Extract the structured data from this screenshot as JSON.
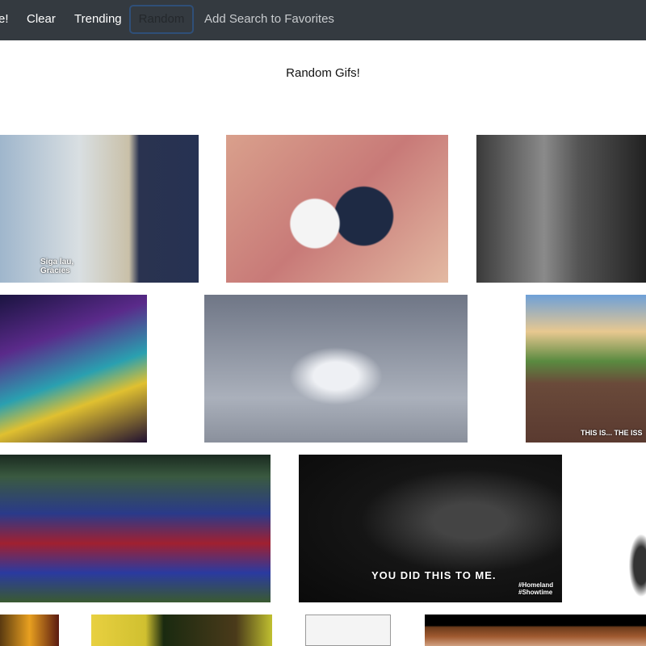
{
  "nav": {
    "partial": "e!",
    "clear": "Clear",
    "trending": "Trending",
    "random": "Random",
    "favorites": "Add Search to Favorites"
  },
  "page_title": "Random Gifs!",
  "captions": {
    "gif1": "Siga lau, Gracies",
    "gif6": "THIS IS... THE ISS",
    "gif8": "YOU DID THIS TO ME.",
    "gif8_tag": "#Homeland #Showtime"
  }
}
